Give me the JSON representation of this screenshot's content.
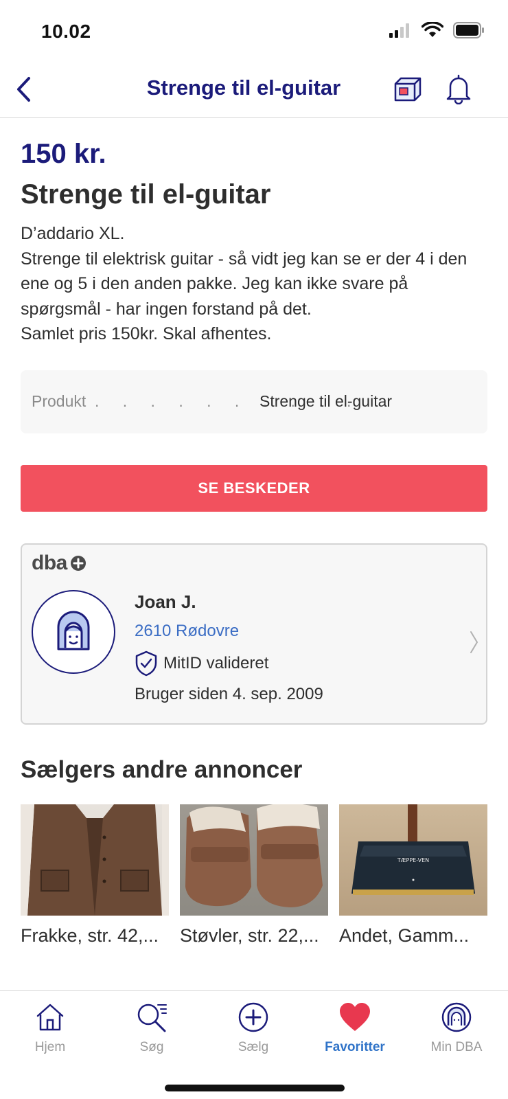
{
  "status_bar": {
    "time": "10.02"
  },
  "nav": {
    "title": "Strenge til el-guitar",
    "back_icon": "chevron-left-icon",
    "box_icon": "shipping-box-icon",
    "bell_icon": "bell-icon"
  },
  "listing": {
    "price": "150 kr.",
    "title": "Strenge til el-guitar",
    "description": "D’addario XL.\nStrenge til elektrisk guitar - så vidt jeg kan se er der 4 i den ene og 5 i den anden pakke. Jeg kan ikke svare på spørgsmål - har ingen forstand på det.\nSamlet pris 150kr. Skal afhentes.",
    "spec": {
      "label": "Produkt",
      "dots": ". . . . . . . . . .",
      "value": "Strenge til el-guitar"
    }
  },
  "cta": {
    "label": "SE BESKEDER"
  },
  "seller": {
    "logo_text": "dba",
    "name": "Joan J.",
    "location": "2610 Rødovre",
    "verified_text": "MitID valideret",
    "since_text": "Bruger siden 4. sep. 2009"
  },
  "other_listings": {
    "title": "Sælgers andre annoncer",
    "items": [
      {
        "title": "Frakke, str. 42,..."
      },
      {
        "title": "Støvler, str. 22,..."
      },
      {
        "title": "Andet, Gamm..."
      }
    ]
  },
  "tab_bar": {
    "tabs": [
      {
        "label": "Hjem",
        "icon": "home-icon"
      },
      {
        "label": "Søg",
        "icon": "search-icon"
      },
      {
        "label": "Sælg",
        "icon": "plus-circle-icon"
      },
      {
        "label": "Favoritter",
        "icon": "heart-icon"
      },
      {
        "label": "Min DBA",
        "icon": "user-avatar-icon"
      }
    ],
    "active": "Favoritter"
  },
  "colors": {
    "brand_navy": "#1b1b7a",
    "cta_red": "#f2515e",
    "link_blue": "#3b6dc4",
    "favorite_red": "#e8384f"
  }
}
